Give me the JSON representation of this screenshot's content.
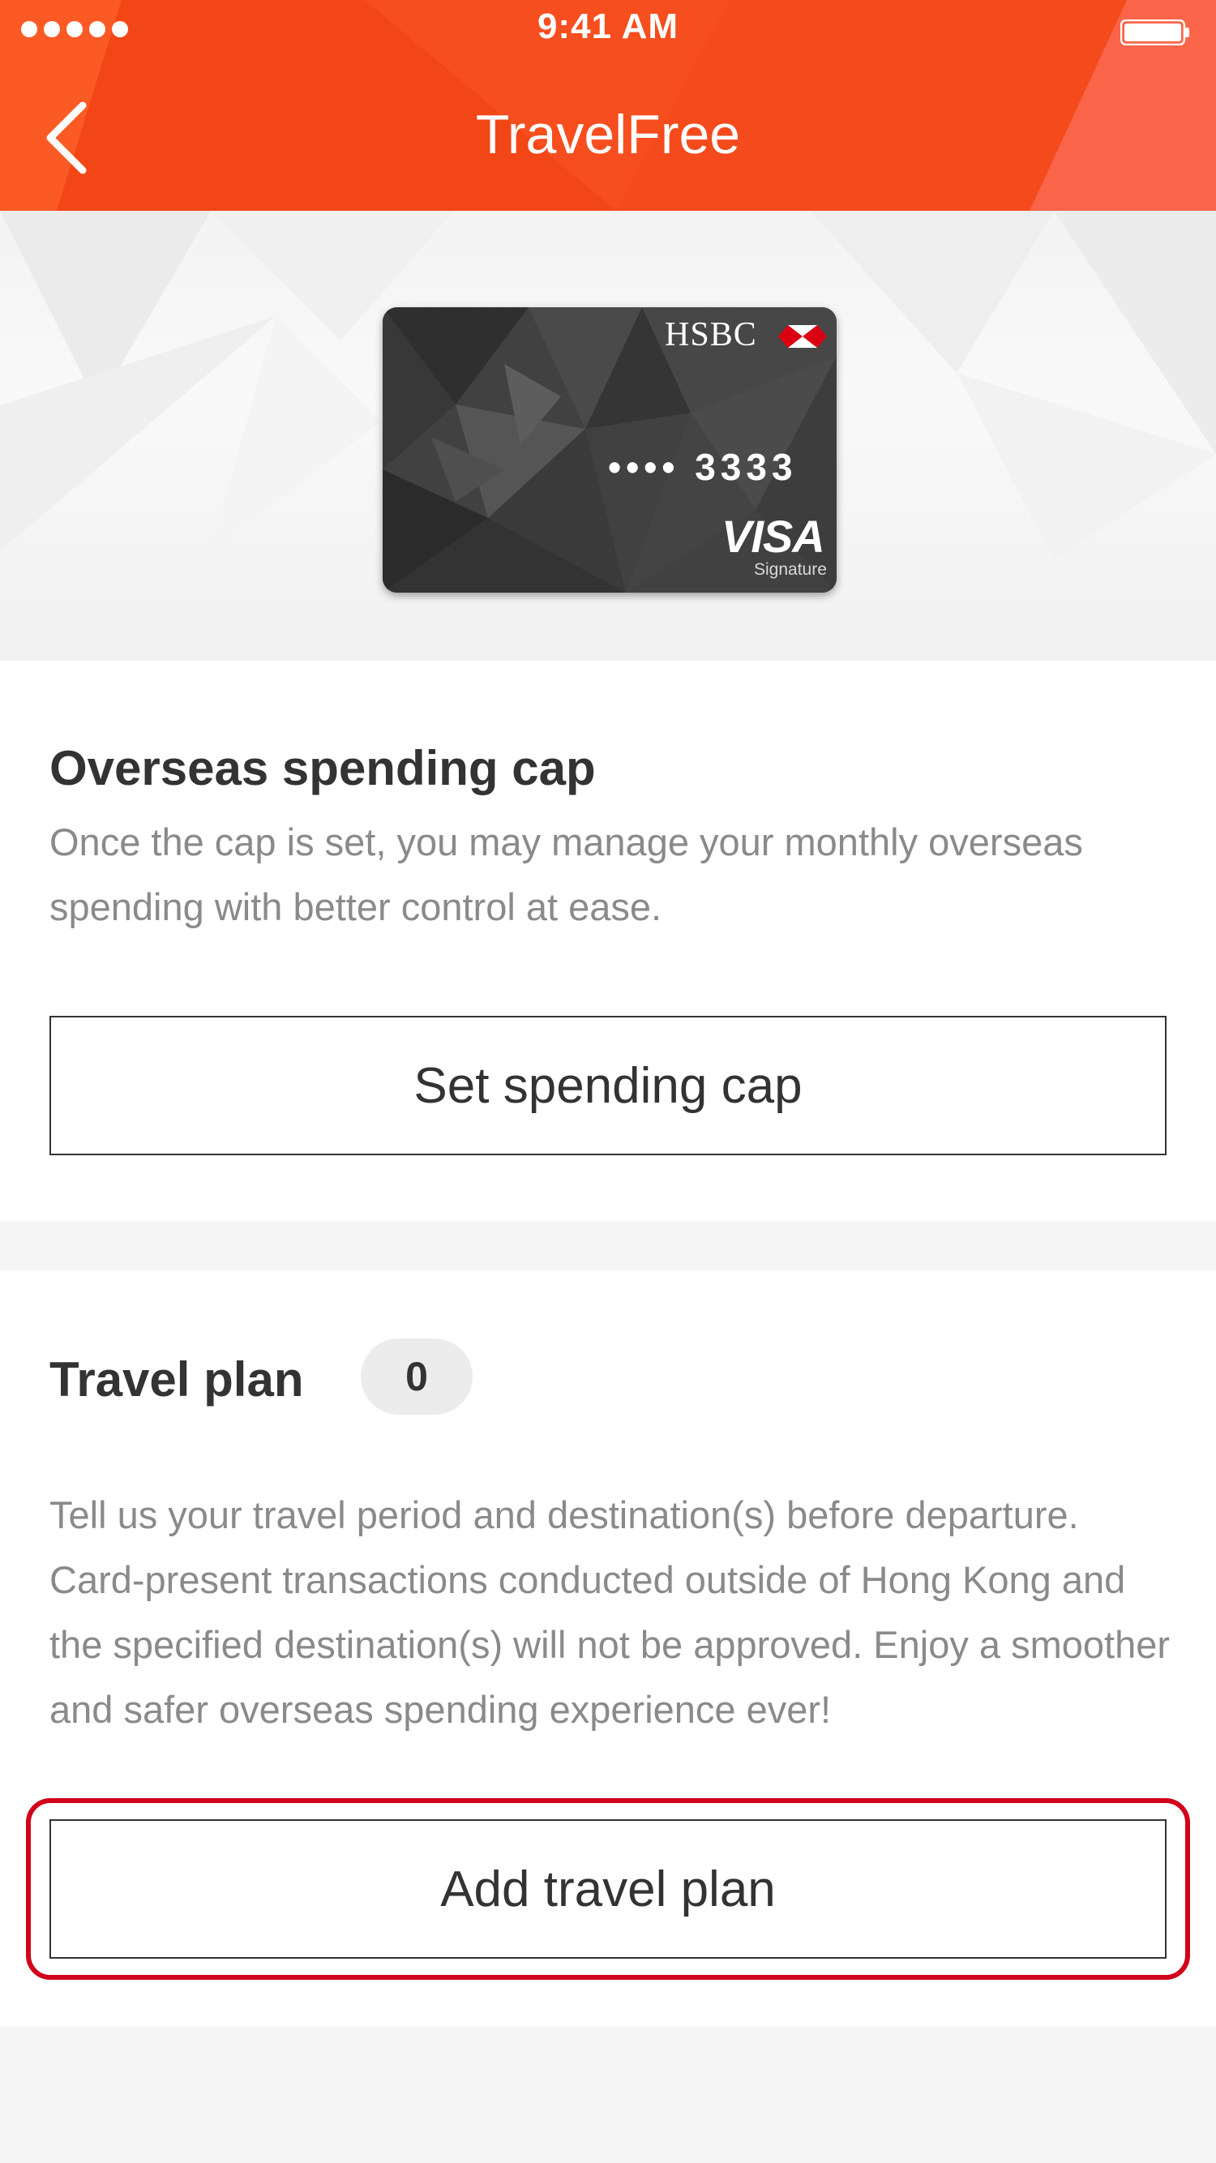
{
  "status_bar": {
    "time": "9:41 AM"
  },
  "nav": {
    "title": "TravelFree",
    "back_icon": "chevron-left-icon"
  },
  "card": {
    "brand": "HSBC",
    "number_masked": "•••• 3333",
    "network": "VISA",
    "tier": "Signature"
  },
  "spending_cap": {
    "title": "Overseas spending cap",
    "description": "Once the cap is set, you may manage your monthly overseas spending with better control at ease.",
    "button_label": "Set spending cap"
  },
  "travel_plan": {
    "title": "Travel plan",
    "count": "0",
    "description": "Tell us your travel period and destination(s) before departure. Card-present transactions conducted outside of Hong Kong and the specified destination(s) will not be approved. Enjoy a smoother and safer overseas spending experience ever!",
    "button_label": "Add travel plan"
  },
  "colors": {
    "header_orange": "#f5491e",
    "highlight_red": "#d0021b",
    "text_dark": "#333333",
    "text_grey": "#8a8a8a"
  }
}
